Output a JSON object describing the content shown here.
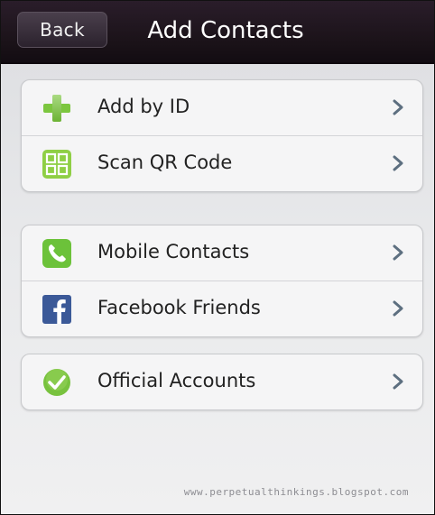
{
  "nav": {
    "back_label": "Back",
    "title": "Add Contacts"
  },
  "groups": [
    {
      "items": [
        {
          "label": "Add by ID",
          "icon": "plus-icon"
        },
        {
          "label": "Scan QR Code",
          "icon": "qr-code-icon"
        }
      ]
    },
    {
      "items": [
        {
          "label": "Mobile Contacts",
          "icon": "phone-icon"
        },
        {
          "label": "Facebook Friends",
          "icon": "facebook-icon"
        }
      ]
    },
    {
      "items": [
        {
          "label": "Official Accounts",
          "icon": "verified-check-icon"
        }
      ]
    }
  ],
  "watermark": "www.perpetualthinkings.blogspot.com",
  "colors": {
    "nav_bg": "#1a1218",
    "accent_green": "#7cc63f",
    "facebook_blue": "#3b5998"
  }
}
